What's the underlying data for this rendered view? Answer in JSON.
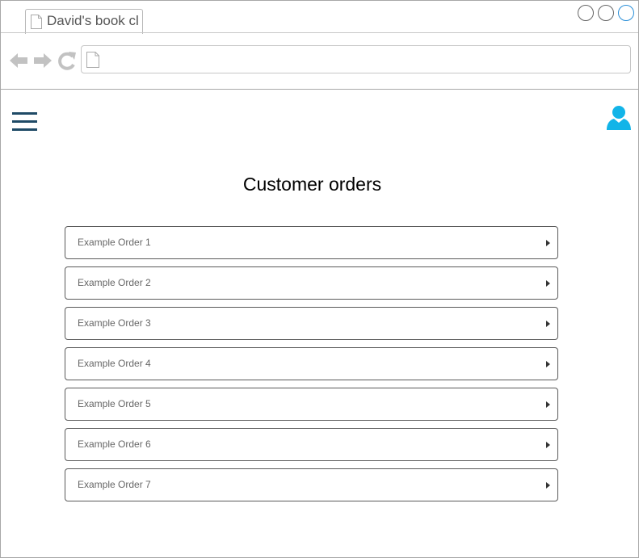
{
  "browser": {
    "tab_title": "David's book cl",
    "address": "",
    "window_controls": [
      "minimize",
      "maximize",
      "close"
    ],
    "nav_icons": [
      "back-arrow-icon",
      "forward-arrow-icon",
      "reload-icon"
    ]
  },
  "header": {
    "menu_icon": "hamburger-menu-icon",
    "user_icon": "user-profile-icon",
    "accent_color": "#1f4a66",
    "user_icon_color": "#12b4e8"
  },
  "main": {
    "title": "Customer orders",
    "orders": [
      {
        "label": "Example Order 1"
      },
      {
        "label": "Example Order 2"
      },
      {
        "label": "Example Order 3"
      },
      {
        "label": "Example Order 4"
      },
      {
        "label": "Example Order 5"
      },
      {
        "label": "Example Order 6"
      },
      {
        "label": "Example Order 7"
      }
    ]
  }
}
